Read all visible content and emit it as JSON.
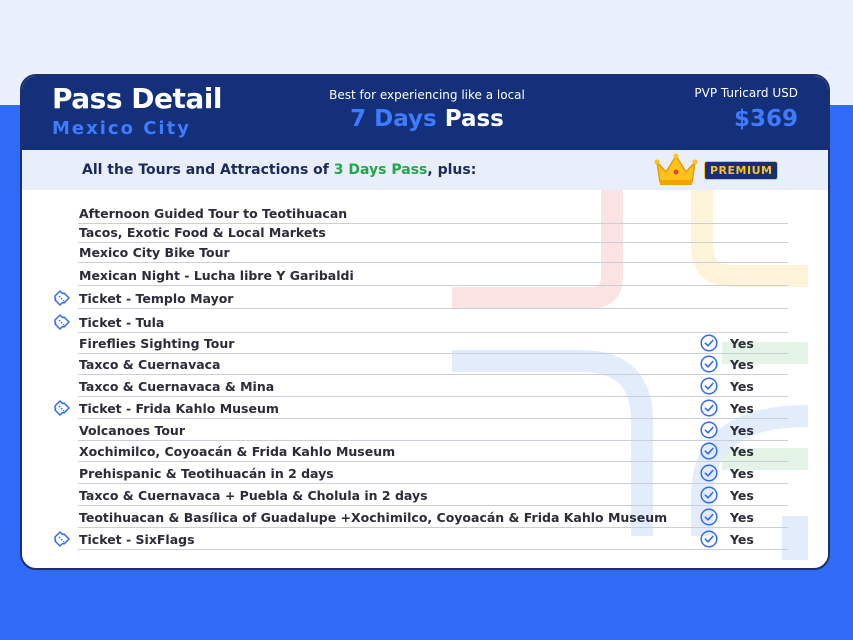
{
  "header": {
    "title": "Pass Detail",
    "city": "Mexico City",
    "tagline": "Best for experiencing like a local",
    "pass_days": "7 Days",
    "pass_word": "Pass",
    "price_label": "PVP Turicard USD",
    "price": "$369"
  },
  "subheader": {
    "prefix": "All the Tours and Attractions of ",
    "highlight": "3 Days Pass",
    "suffix": ", plus:",
    "badge": "PREMIUM"
  },
  "colors": {
    "navy": "#14307a",
    "accent": "#3d7bff",
    "green": "#1fa84a",
    "gold": "#ffc21a"
  },
  "items": [
    {
      "label": "Afternoon Guided Tour to Teotihuacan",
      "ticket": false,
      "yes": ""
    },
    {
      "label": "Tacos, Exotic Food & Local Markets",
      "ticket": false,
      "yes": ""
    },
    {
      "label": "Mexico City Bike Tour",
      "ticket": false,
      "yes": ""
    },
    {
      "label": "Mexican Night - Lucha libre Y Garibaldi",
      "ticket": false,
      "yes": ""
    },
    {
      "label": "Ticket - Templo Mayor",
      "ticket": true,
      "yes": ""
    },
    {
      "label": "Ticket - Tula",
      "ticket": true,
      "yes": ""
    },
    {
      "label": "Fireflies Sighting Tour",
      "ticket": false,
      "yes": "Yes"
    },
    {
      "label": "Taxco & Cuernavaca",
      "ticket": false,
      "yes": "Yes"
    },
    {
      "label": "Taxco & Cuernavaca & Mina",
      "ticket": false,
      "yes": "Yes"
    },
    {
      "label": "Ticket - Frida Kahlo Museum",
      "ticket": true,
      "yes": "Yes"
    },
    {
      "label": "Volcanoes Tour",
      "ticket": false,
      "yes": "Yes"
    },
    {
      "label": "Xochimilco, Coyoacán & Frida Kahlo Museum",
      "ticket": false,
      "yes": "Yes"
    },
    {
      "label": "Prehispanic & Teotihuacán in 2 days",
      "ticket": false,
      "yes": "Yes"
    },
    {
      "label": "Taxco & Cuernavaca + Puebla & Cholula in 2 days",
      "ticket": false,
      "yes": "Yes"
    },
    {
      "label": "Teotihuacan & Basílica of Guadalupe  +Xochimilco, Coyoacán & Frida Kahlo Museum",
      "ticket": false,
      "yes": "Yes"
    },
    {
      "label": "Ticket - SixFlags",
      "ticket": true,
      "yes": "Yes"
    }
  ]
}
